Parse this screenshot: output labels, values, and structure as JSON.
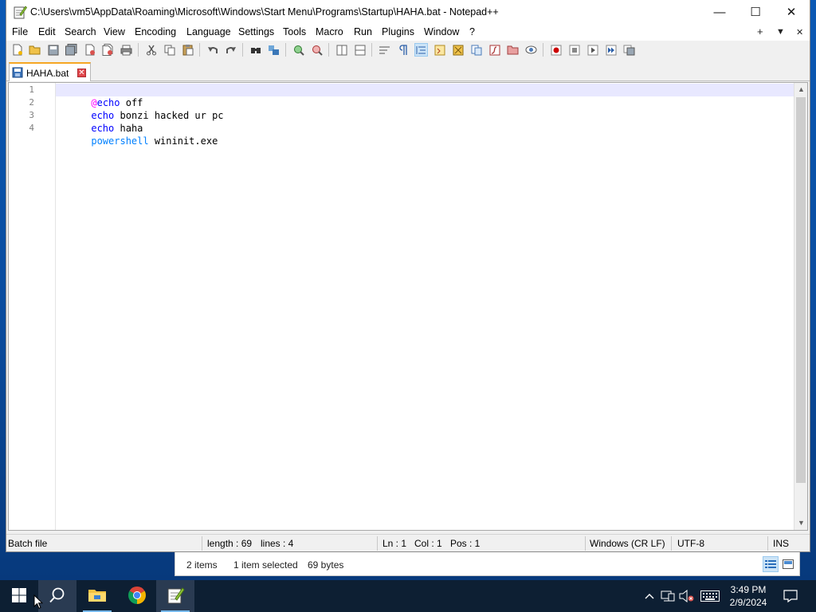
{
  "notepad": {
    "title": "C:\\Users\\vm5\\AppData\\Roaming\\Microsoft\\Windows\\Start Menu\\Programs\\Startup\\HAHA.bat - Notepad++",
    "window_controls": {
      "minimize": "—",
      "maximize": "☐",
      "close": "✕"
    },
    "menu": [
      "File",
      "Edit",
      "Search",
      "View",
      "Encoding",
      "Language",
      "Settings",
      "Tools",
      "Macro",
      "Run",
      "Plugins",
      "Window",
      "?"
    ],
    "menu_right": {
      "add": "+",
      "dropdown": "▼",
      "close": "✕"
    },
    "tab": {
      "label": "HAHA.bat",
      "close": "✕"
    },
    "editor": {
      "line_numbers": [
        "1",
        "2",
        "3",
        "4"
      ],
      "lines": [
        [
          {
            "t": "@",
            "c": "at"
          },
          {
            "t": "echo",
            "c": "kw"
          },
          {
            "t": " off",
            "c": "text"
          }
        ],
        [
          {
            "t": "echo",
            "c": "kw"
          },
          {
            "t": " bonzi hacked ur pc",
            "c": "text"
          }
        ],
        [
          {
            "t": "echo",
            "c": "kw"
          },
          {
            "t": " haha",
            "c": "text"
          }
        ],
        [
          {
            "t": "powershell",
            "c": "ps"
          },
          {
            "t": " wininit.exe",
            "c": "text"
          }
        ]
      ],
      "current_line": 1
    },
    "status": {
      "file_type": "Batch file",
      "length": "length : 69",
      "lines": "lines : 4",
      "ln": "Ln : 1",
      "col": "Col : 1",
      "pos": "Pos : 1",
      "eol": "Windows (CR LF)",
      "encoding": "UTF-8",
      "mode": "INS"
    },
    "colors": {
      "keyword": "#0000ff",
      "at_sign": "#ff00ff",
      "powershell": "#0080ff",
      "current_line": "#e8e8ff",
      "tab_accent": "#f5a623"
    }
  },
  "explorer": {
    "item_count": "2 items",
    "selection": "1 item selected",
    "size": "69 bytes"
  },
  "taskbar": {
    "apps": [
      "windows-start",
      "search",
      "file-explorer",
      "chrome",
      "notepad-plus-plus"
    ],
    "clock": {
      "time": "3:49 PM",
      "date": "2/9/2024"
    }
  }
}
